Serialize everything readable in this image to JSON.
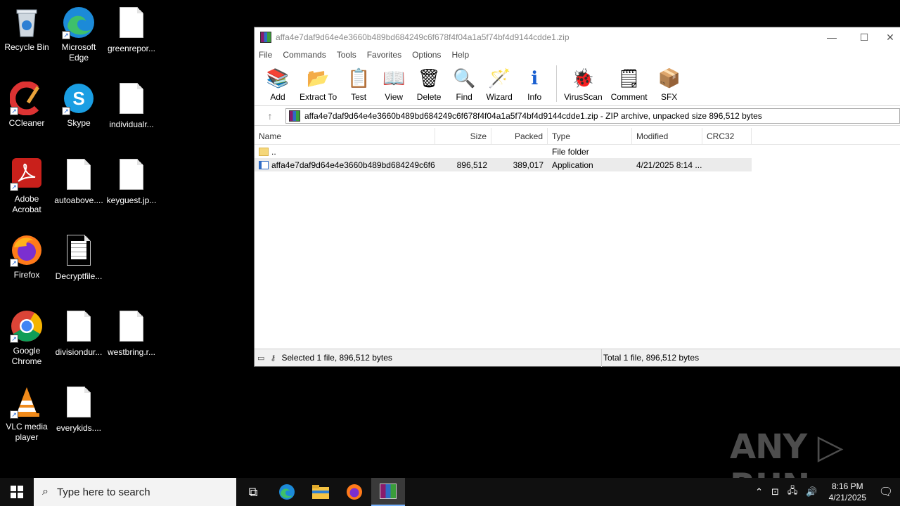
{
  "desktop": {
    "icons": [
      {
        "label": "Recycle Bin",
        "icon": "recycle-bin-icon"
      },
      {
        "label": "Microsoft Edge",
        "icon": "edge-icon"
      },
      {
        "label": "greenrepor...",
        "icon": "file-icon"
      },
      {
        "label": "CCleaner",
        "icon": "ccleaner-icon"
      },
      {
        "label": "Skype",
        "icon": "skype-icon"
      },
      {
        "label": "individualr...",
        "icon": "file-icon"
      },
      {
        "label": "Adobe Acrobat",
        "icon": "acrobat-icon"
      },
      {
        "label": "autoabove....",
        "icon": "file-icon"
      },
      {
        "label": "keyguest.jp...",
        "icon": "file-icon"
      },
      {
        "label": "Firefox",
        "icon": "firefox-icon"
      },
      {
        "label": "Decryptfile...",
        "icon": "text-file-icon"
      },
      {
        "label": "Google Chrome",
        "icon": "chrome-icon"
      },
      {
        "label": "divisiondur...",
        "icon": "file-icon"
      },
      {
        "label": "westbring.r...",
        "icon": "file-icon"
      },
      {
        "label": "VLC media player",
        "icon": "vlc-icon"
      },
      {
        "label": "everykids....",
        "icon": "file-icon"
      }
    ]
  },
  "window": {
    "title": "affa4e7daf9d64e4e3660b489bd684249c6f678f4f04a1a5f74bf4d9144cdde1.zip",
    "controls": {
      "minimize": "—",
      "maximize": "☐",
      "close": "✕"
    },
    "menu": [
      "File",
      "Commands",
      "Tools",
      "Favorites",
      "Options",
      "Help"
    ],
    "toolbar": [
      {
        "label": "Add",
        "icon": "add-icon",
        "glyph": "📚"
      },
      {
        "label": "Extract To",
        "icon": "extract-icon",
        "glyph": "📂"
      },
      {
        "label": "Test",
        "icon": "test-icon",
        "glyph": "📋"
      },
      {
        "label": "View",
        "icon": "view-icon",
        "glyph": "📖"
      },
      {
        "label": "Delete",
        "icon": "delete-icon",
        "glyph": "🗑"
      },
      {
        "label": "Find",
        "icon": "find-icon",
        "glyph": "🔍"
      },
      {
        "label": "Wizard",
        "icon": "wizard-icon",
        "glyph": "🪄"
      },
      {
        "label": "Info",
        "icon": "info-icon",
        "glyph": "ℹ"
      },
      {
        "label": "VirusScan",
        "icon": "virusscan-icon",
        "glyph": "🐞"
      },
      {
        "label": "Comment",
        "icon": "comment-icon",
        "glyph": "🗒"
      },
      {
        "label": "SFX",
        "icon": "sfx-icon",
        "glyph": "📦"
      }
    ],
    "address": "affa4e7daf9d64e4e3660b489bd684249c6f678f4f04a1a5f74bf4d9144cdde1.zip - ZIP archive, unpacked size 896,512 bytes",
    "columns": {
      "name": "Name",
      "size": "Size",
      "packed": "Packed",
      "type": "Type",
      "modified": "Modified",
      "crc": "CRC32"
    },
    "rows": [
      {
        "name": "..",
        "size": "",
        "packed": "",
        "type": "File folder",
        "modified": "",
        "crc": ""
      },
      {
        "name": "affa4e7daf9d64e4e3660b489bd684249c6f6...",
        "size": "896,512",
        "packed": "389,017",
        "type": "Application",
        "modified": "4/21/2025 8:14 ...",
        "crc": ""
      }
    ],
    "status_left": "Selected 1 file, 896,512 bytes",
    "status_right": "Total 1 file, 896,512 bytes"
  },
  "watermark": "ANY ▷ RUN",
  "taskbar": {
    "search_placeholder": "Type here to search",
    "time": "8:16 PM",
    "date": "4/21/2025"
  }
}
